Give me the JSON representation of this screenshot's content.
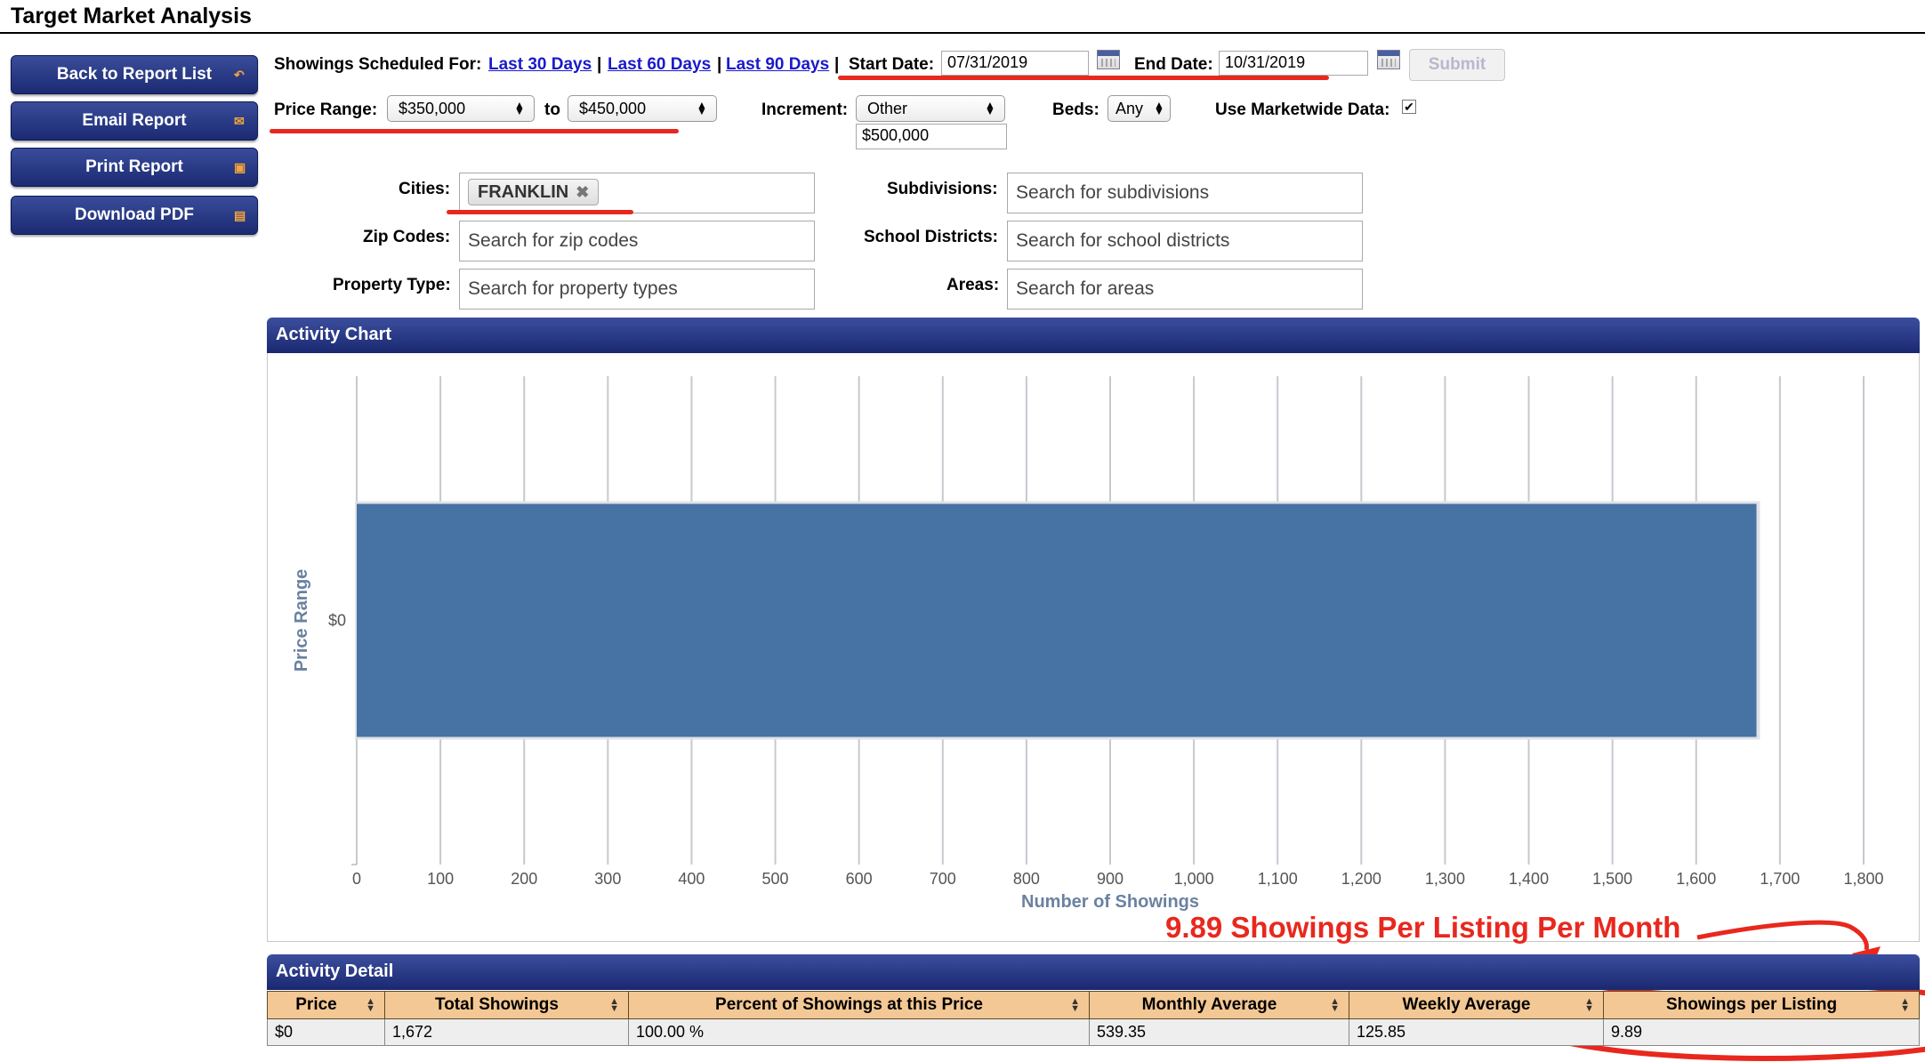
{
  "page": {
    "title": "Target Market Analysis"
  },
  "sidebar": {
    "buttons": [
      {
        "label": "Back to Report List",
        "icon": "back-arrow-icon"
      },
      {
        "label": "Email Report",
        "icon": "email-icon"
      },
      {
        "label": "Print Report",
        "icon": "print-icon"
      },
      {
        "label": "Download PDF",
        "icon": "save-icon"
      }
    ]
  },
  "filters": {
    "showings_label": "Showings Scheduled For:",
    "last30": "Last 30 Days",
    "last60": "Last 60 Days",
    "last90": "Last 90 Days",
    "pipe": "|",
    "start_label": "Start Date:",
    "start_value": "07/31/2019",
    "end_label": "End Date:",
    "end_value": "10/31/2019",
    "submit": "Submit",
    "price_label": "Price Range:",
    "price_from": "$350,000",
    "to": "to",
    "price_to": "$450,000",
    "increment_label": "Increment:",
    "increment_value": "Other",
    "increment_amount": "$500,000",
    "beds_label": "Beds:",
    "beds_value": "Any",
    "marketwide_label": "Use Marketwide Data:",
    "marketwide_checked": "✔",
    "cities_label": "Cities:",
    "city_tag": "FRANKLIN",
    "zip_label": "Zip Codes:",
    "zip_placeholder": "Search for zip codes",
    "ptype_label": "Property Type:",
    "ptype_placeholder": "Search for property types",
    "subdiv_label": "Subdivisions:",
    "subdiv_placeholder": "Search for subdivisions",
    "school_label": "School Districts:",
    "school_placeholder": "Search for school districts",
    "areas_label": "Areas:",
    "areas_placeholder": "Search for areas"
  },
  "activity_chart": {
    "header": "Activity Chart"
  },
  "chart_data": {
    "type": "bar",
    "orientation": "horizontal",
    "categories": [
      "$0"
    ],
    "values": [
      1672
    ],
    "xlabel": "Number of Showings",
    "ylabel": "Price Range",
    "xlim": [
      0,
      1800
    ],
    "xticks": [
      "0",
      "100",
      "200",
      "300",
      "400",
      "500",
      "600",
      "700",
      "800",
      "900",
      "1,000",
      "1,100",
      "1,200",
      "1,300",
      "1,400",
      "1,500",
      "1,600",
      "1,700",
      "1,800"
    ],
    "grid": true,
    "bar_color": "#4672a4"
  },
  "annotation": {
    "text": "9.89 Showings Per Listing Per Month",
    "color": "#e8281e"
  },
  "activity_detail": {
    "header": "Activity Detail",
    "columns": [
      "Price",
      "Total Showings",
      "Percent of Showings at this Price",
      "Monthly Average",
      "Weekly Average",
      "Showings per Listing"
    ],
    "rows": [
      [
        "$0",
        "1,672",
        "100.00 %",
        "539.35",
        "125.85",
        "9.89"
      ]
    ]
  }
}
